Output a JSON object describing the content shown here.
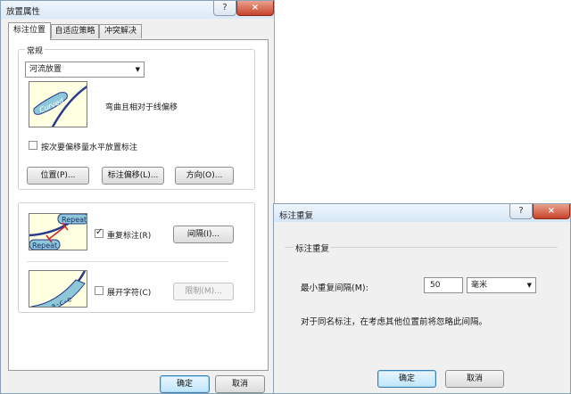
{
  "placement_dialog": {
    "title": "放置属性",
    "caption_help": "?",
    "caption_close": "×",
    "tabs": [
      "标注位置",
      "自适应策略",
      "冲突解决"
    ],
    "general_group": "常规",
    "placement_select": "河流放置",
    "curved_sample_text": "Curved",
    "curved_description": "弯曲且相对于线偏移",
    "horizontal_offset_checkbox": "按次要偏移量水平放置标注",
    "horizontal_offset_checked": false,
    "position_button": "位置(P)...",
    "label_offset_button": "标注偏移(L)...",
    "direction_button": "方向(O)...",
    "repeat_sample_text": "Repeat",
    "repeat_label_checkbox": "重复标注(R)",
    "repeat_label_checked": true,
    "interval_button": "间隔(I)...",
    "spread_sample_text": "S-p-a-c-e",
    "spread_chars_checkbox": "展开字符(C)",
    "spread_chars_checked": false,
    "limit_button": "限制(M)...",
    "ok_button": "确定",
    "cancel_button": "取消"
  },
  "repeat_dialog": {
    "title": "标注重复",
    "caption_help": "?",
    "caption_close": "×",
    "group_title": "标注重复",
    "min_interval_label": "最小重复间隔(M):",
    "min_interval_value": "50",
    "unit_select": "毫米",
    "note": "对于同名标注，在考虑其他位置前将忽略此间隔。",
    "ok_button": "确定",
    "cancel_button": "取消"
  },
  "colors": {
    "preview_bg": "#ffffe1",
    "label_bubble": "#8ec8d8",
    "river_line": "#2a3a8c",
    "repeat_bracket": "#d02020"
  }
}
